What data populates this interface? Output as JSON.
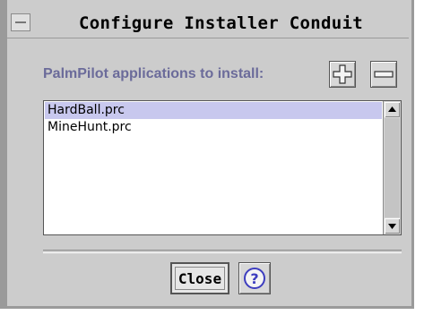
{
  "window": {
    "title": "Configure Installer Conduit",
    "menu_icon": "window-menu-icon"
  },
  "section": {
    "label": "PalmPilot applications to install:"
  },
  "toolbar": {
    "add_icon": "plus-icon",
    "remove_icon": "minus-icon"
  },
  "list": {
    "items": [
      {
        "label": "HardBall.prc",
        "selected": true
      },
      {
        "label": "MineHunt.prc",
        "selected": false
      }
    ]
  },
  "buttons": {
    "close_label": "Close",
    "help_icon": "help-icon"
  },
  "colors": {
    "background": "#cccccc",
    "label": "#6b6b9a",
    "selection": "#c8c8ee",
    "help_accent": "#3d3dbf"
  }
}
